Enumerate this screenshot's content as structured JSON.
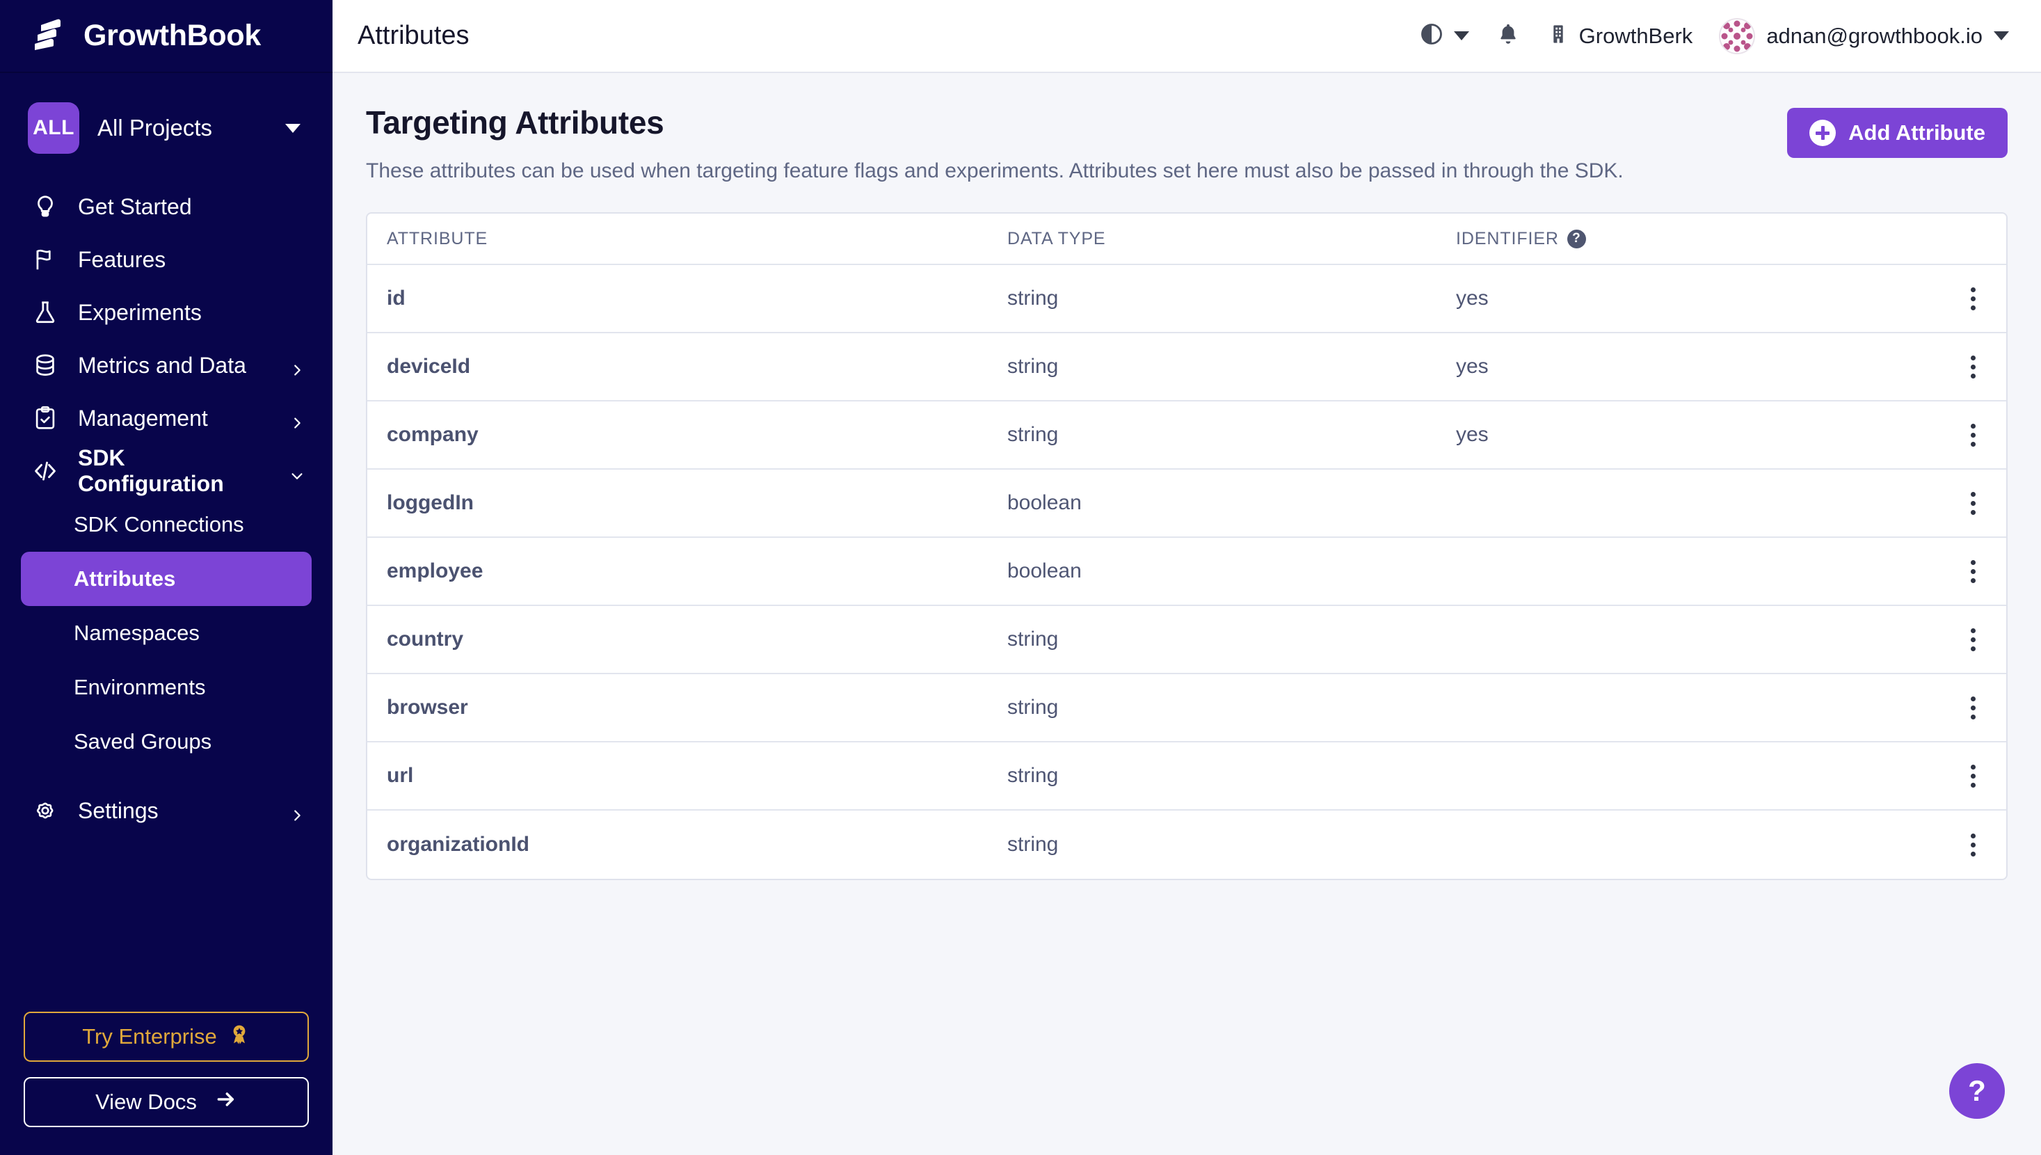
{
  "sidebar": {
    "brand": "GrowthBook",
    "project": {
      "badge": "ALL",
      "name": "All Projects"
    },
    "nav": [
      {
        "label": "Get Started",
        "icon": "lightbulb-icon",
        "expandable": false
      },
      {
        "label": "Features",
        "icon": "flag-icon",
        "expandable": false
      },
      {
        "label": "Experiments",
        "icon": "flask-icon",
        "expandable": false
      },
      {
        "label": "Metrics and Data",
        "icon": "database-icon",
        "expandable": true
      },
      {
        "label": "Management",
        "icon": "clipboard-check-icon",
        "expandable": true
      },
      {
        "label": "SDK Configuration",
        "icon": "code-brackets-icon",
        "expandable": true
      }
    ],
    "subnav": [
      {
        "label": "SDK Connections",
        "active": false
      },
      {
        "label": "Attributes",
        "active": true
      },
      {
        "label": "Namespaces",
        "active": false
      },
      {
        "label": "Environments",
        "active": false
      },
      {
        "label": "Saved Groups",
        "active": false
      }
    ],
    "settings": {
      "label": "Settings",
      "icon": "gear-icon"
    },
    "enterprise_button": "Try Enterprise",
    "docs_button": "View Docs",
    "colors": {
      "background": "#08054b",
      "active": "#7c44d6",
      "enterprise": "#e0a83b"
    }
  },
  "topbar": {
    "title": "Attributes",
    "theme_toggle": "contrast-icon",
    "notifications": "bell-icon",
    "org_name": "GrowthBerk",
    "user_email": "adnan@growthbook.io"
  },
  "page": {
    "title": "Targeting Attributes",
    "subtitle": "These attributes can be used when targeting feature flags and experiments. Attributes set here must also be passed in through the SDK.",
    "add_button": "Add Attribute"
  },
  "table": {
    "columns": [
      "ATTRIBUTE",
      "DATA TYPE",
      "IDENTIFIER"
    ],
    "identifier_help": "?",
    "rows": [
      {
        "attribute": "id",
        "data_type": "string",
        "identifier": "yes"
      },
      {
        "attribute": "deviceId",
        "data_type": "string",
        "identifier": "yes"
      },
      {
        "attribute": "company",
        "data_type": "string",
        "identifier": "yes"
      },
      {
        "attribute": "loggedIn",
        "data_type": "boolean",
        "identifier": ""
      },
      {
        "attribute": "employee",
        "data_type": "boolean",
        "identifier": ""
      },
      {
        "attribute": "country",
        "data_type": "string",
        "identifier": ""
      },
      {
        "attribute": "browser",
        "data_type": "string",
        "identifier": ""
      },
      {
        "attribute": "url",
        "data_type": "string",
        "identifier": ""
      },
      {
        "attribute": "organizationId",
        "data_type": "string",
        "identifier": ""
      }
    ]
  },
  "help_fab": "?"
}
